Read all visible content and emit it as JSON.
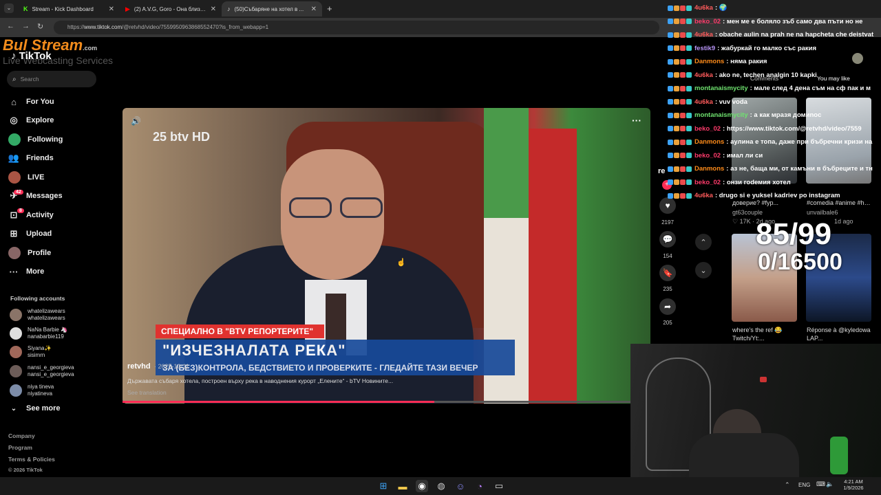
{
  "browser": {
    "tabs": [
      {
        "label": "Stream - Kick Dashboard",
        "icon": "kick-icon",
        "color": "#53fc18"
      },
      {
        "label": "(2) A.V.G, Goro - Она близко (",
        "icon": "youtube-icon",
        "color": "#ff0000"
      },
      {
        "label": "(50)Събаряне на хотел в ...",
        "icon": "tiktok-icon",
        "color": "#ffffff"
      }
    ],
    "url_prefix": "https://",
    "url_domain": "www.tiktok.com",
    "url_path": "/@retvhd/video/7559950963868552470?is_from_webapp=1"
  },
  "overlay": {
    "bulstream_title": "Bul Stream",
    "bulstream_com": ".com",
    "bulstream_sub": "Live Webcasting Services",
    "tiktok_logo": "TikTok",
    "counter_main": "85/99",
    "counter_sub": "0/16500"
  },
  "sidebar": {
    "search_placeholder": "Search",
    "nav": [
      {
        "label": "For You",
        "icon": "home-icon"
      },
      {
        "label": "Explore",
        "icon": "compass-icon"
      },
      {
        "label": "Following",
        "icon": "following-icon"
      },
      {
        "label": "Friends",
        "icon": "friends-icon"
      },
      {
        "label": "LIVE",
        "icon": "live-icon"
      },
      {
        "label": "Messages",
        "icon": "messages-icon",
        "badge": "42"
      },
      {
        "label": "Activity",
        "icon": "activity-icon",
        "badge": "8"
      },
      {
        "label": "Upload",
        "icon": "upload-icon"
      },
      {
        "label": "Profile",
        "icon": "profile-icon"
      },
      {
        "label": "More",
        "icon": "more-icon"
      }
    ],
    "following_header": "Following accounts",
    "accounts": [
      {
        "name": "whatelizawears",
        "handle": "whatelizawears"
      },
      {
        "name": "NaNa Barbie 🦄",
        "handle": "nanabarbie119"
      },
      {
        "name": "Siyana✨",
        "handle": "sisimrn"
      },
      {
        "name": "nansi_e_georgieva",
        "handle": "nansi_e_georgieva"
      },
      {
        "name": "niya tineva",
        "handle": "niyatineva"
      }
    ],
    "see_more": "See more",
    "footer": [
      "Company",
      "Program",
      "Terms & Policies",
      "© 2026 TikTok"
    ]
  },
  "video": {
    "channel_logo": "25 btv HD",
    "lower_third_tag": "СПЕЦИАЛНО В \"BTV РЕПОРТЕРИТЕ\"",
    "lower_third_title": "\"ИЗЧЕЗНАЛАТА РЕКА\"",
    "lower_third_sub": "ЗА (БЕЗ)КОНТРОЛА, БЕДСТВИЕТО И ПРОВЕРКИТЕ - ГЛЕДАЙТЕ ТАЗИ ВЕЧЕР",
    "author": "retvhd",
    "date": "· 2025-10-11",
    "description": "Държавата събаря хотела, построен върху река в наводнения курорт „Елените“ - bTV Новините...",
    "see_translation": "See translation",
    "progress": 0.59
  },
  "actions": {
    "likes": "2197",
    "comments": "154",
    "saves": "235",
    "shares": "205"
  },
  "right_panel": {
    "tab_comments": "Comments",
    "tab_you_may_like": "You may like",
    "cards": [
      {
        "caption": "доверие? #fyp...",
        "author": "gt63couple",
        "meta": "♡ 17K · 2d ago"
      },
      {
        "caption": "#comedia #anime #humor #fyp #fyp",
        "author": "unvailbale6",
        "meta": "1d ago"
      },
      {
        "caption": "where's the ref 😂 Twitch/Yt:...",
        "author": "",
        "meta": ""
      },
      {
        "caption": "Réponse à @kyledowa LAP...",
        "author": "",
        "meta": ""
      }
    ]
  },
  "chat": [
    {
      "user": "4u6ka",
      "color": "#ff5b5b",
      "text": ": 🌍"
    },
    {
      "user": "beko_02",
      "color": "#ff3b6b",
      "text": ": мен ме е боляло зъб само два пъти но не"
    },
    {
      "user": "4u6ka",
      "color": "#ff5b5b",
      "text": ": obache aulin na prah ne na hapcheta che deistvat"
    },
    {
      "user": "festik9",
      "color": "#b794f6",
      "text": ": жабуркай го малко със ракия"
    },
    {
      "user": "Danmons",
      "color": "#ff8c1a",
      "text": ": няма ракия"
    },
    {
      "user": "4u6ka",
      "color": "#ff5b5b",
      "text": ": ako ne, techen analgin 10 kapki"
    },
    {
      "user": "montanaismycity",
      "color": "#6fe36f",
      "text": ": мале след 4 дена съм на сф пак и м"
    },
    {
      "user": "4u6ka",
      "color": "#ff5b5b",
      "text": ": vuv voda"
    },
    {
      "user": "montanaismycity",
      "color": "#6fe36f",
      "text": ": а как мразя домиnoc"
    },
    {
      "user": "beko_02",
      "color": "#ff3b6b",
      "text": ": https://www.tiktok.com/@retvhd/video/7559"
    },
    {
      "user": "Danmons",
      "color": "#ff8c1a",
      "text": ": аулина е топа, даже при бъбречни кризи на"
    },
    {
      "user": "beko_02",
      "color": "#ff3b6b",
      "text": ": имал ли си"
    },
    {
      "user": "Danmons",
      "color": "#ff8c1a",
      "text": ": аз не, баща ми, от камъни в бъбреците и тн"
    },
    {
      "user": "beko_02",
      "color": "#ff3b6b",
      "text": ": онзи гоdемия хотел"
    },
    {
      "user": "4u6ka",
      "color": "#ff5b5b",
      "text": ": drugo si e yuksel kadriev po instagram"
    }
  ],
  "taskbar": {
    "lang": "ENG",
    "time": "4:21 AM",
    "date": "1/9/2026"
  },
  "colors": {
    "accent": "#fe2c55",
    "btv_red": "#e0322f",
    "btv_blue": "#174a9a"
  }
}
